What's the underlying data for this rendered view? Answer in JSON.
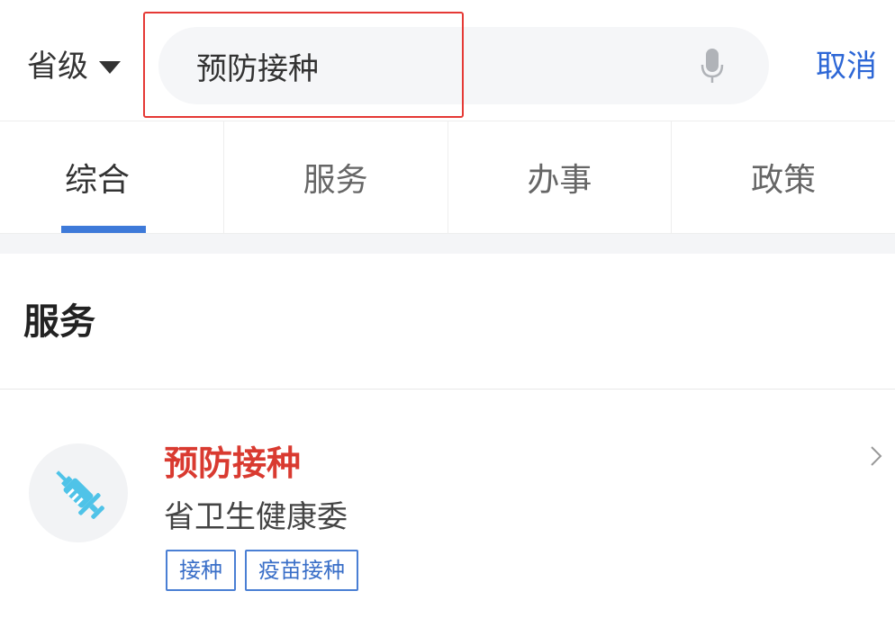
{
  "header": {
    "region_label": "省级",
    "search": {
      "value": "预防接种",
      "placeholder": ""
    },
    "cancel_label": "取消"
  },
  "tabs": [
    {
      "label": "综合",
      "active": true
    },
    {
      "label": "服务",
      "active": false
    },
    {
      "label": "办事",
      "active": false
    },
    {
      "label": "政策",
      "active": false
    }
  ],
  "section": {
    "title": "服务"
  },
  "results": [
    {
      "title": "预防接种",
      "department": "省卫生健康委",
      "icon": "syringe-icon",
      "tags": [
        "接种",
        "疫苗接种"
      ]
    }
  ],
  "colors": {
    "accent_blue": "#2d67d6",
    "tab_underline": "#3e7ad9",
    "result_title_red": "#d93a30",
    "highlight_red": "#e53935",
    "icon_cyan": "#4fc3e8"
  }
}
